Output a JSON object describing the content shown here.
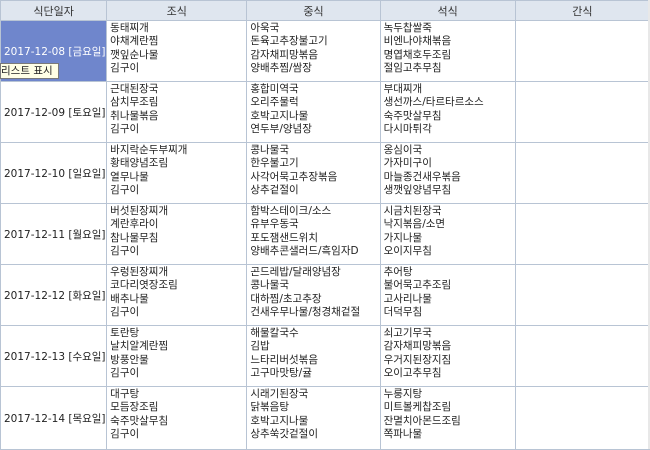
{
  "headers": {
    "date": "식단일자",
    "breakfast": "조식",
    "lunch": "중식",
    "dinner": "석식",
    "snack": "간식"
  },
  "tooltip": "리스트 표시",
  "rows": [
    {
      "date": "2017-12-08 [금요일]",
      "breakfast": [
        "동태찌개",
        "야채계란찜",
        "깻잎순나물",
        "김구이"
      ],
      "lunch": [
        "아욱국",
        "돈육고추장불고기",
        "감자채피망볶음",
        "양배추찜/쌈장"
      ],
      "dinner": [
        "녹두찹쌀죽",
        "비엔나야채볶음",
        "명엽채호두조림",
        "절임고추무침"
      ]
    },
    {
      "date": "2017-12-09 [토요일]",
      "breakfast": [
        "근대된장국",
        "삼치무조림",
        "취나물볶음",
        "김구이"
      ],
      "lunch": [
        "홍합미역국",
        "오리주물럭",
        "호박고지나물",
        "연두부/양념장"
      ],
      "dinner": [
        "부대찌개",
        "생선까스/타르타르소스",
        "숙주맛살무침",
        "다시마튀각"
      ]
    },
    {
      "date": "2017-12-10 [일요일]",
      "breakfast": [
        "바지락순두부찌개",
        "황태양념조림",
        "열무나물",
        "김구이"
      ],
      "lunch": [
        "콩나물국",
        "한우불고기",
        "사각어묵고추장볶음",
        "상추겉절이"
      ],
      "dinner": [
        "옹심이국",
        "가자미구이",
        "마늘종건새우볶음",
        "생깻잎양념무침"
      ]
    },
    {
      "date": "2017-12-11 [월요일]",
      "breakfast": [
        "버섯된장찌개",
        "계란후라이",
        "참나물무침",
        "김구이"
      ],
      "lunch": [
        "함박스테이크/소스",
        "유부우동국",
        "포도잼샌드위치",
        "양배추콘샐러드/흑임자D"
      ],
      "dinner": [
        "시금치된장국",
        "낙지볶음/소면",
        "가지나물",
        "오이지무침"
      ]
    },
    {
      "date": "2017-12-12 [화요일]",
      "breakfast": [
        "우렁된장찌개",
        "코다리엿장조림",
        "배추나물",
        "김구이"
      ],
      "lunch": [
        "곤드레밥/달래양념장",
        "콩나물국",
        "대하찜/초고추장",
        "건새우무나물/청경채겉절"
      ],
      "dinner": [
        "추어탕",
        "불어묵고추조림",
        "고사리나물",
        "더덕무침"
      ]
    },
    {
      "date": "2017-12-13 [수요일]",
      "breakfast": [
        "토란탕",
        "날치알계란찜",
        "방풍안물",
        "김구이"
      ],
      "lunch": [
        "해물칼국수",
        "김밥",
        "느타리버섯볶음",
        "고구마맛탕/귤"
      ],
      "dinner": [
        "쇠고기무국",
        "감자채피망볶음",
        "우거지된장지짐",
        "오이고추무침"
      ]
    },
    {
      "date": "2017-12-14 [목요일]",
      "breakfast": [
        "대구탕",
        "모듬장조림",
        "숙주맛살무침",
        "김구이"
      ],
      "lunch": [
        "시래기된장국",
        "닭볶음탕",
        "호박고지나물",
        "상추쑥갓겉절이"
      ],
      "dinner": [
        "누룽지탕",
        "미트볼케찹조림",
        "잔멸치아몬드조림",
        "쪽파나물"
      ]
    }
  ]
}
